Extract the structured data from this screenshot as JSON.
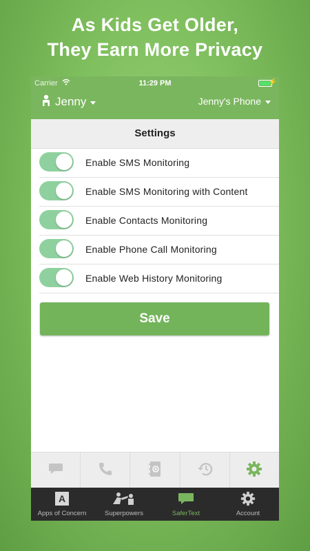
{
  "headline": {
    "line1": "As Kids Get Older,",
    "line2": "They Earn More Privacy"
  },
  "status_bar": {
    "carrier": "Carrier",
    "time": "11:29 PM"
  },
  "nav": {
    "child_name": "Jenny",
    "device_name": "Jenny's Phone"
  },
  "settings": {
    "title": "Settings",
    "rows": [
      {
        "label": "Enable SMS Monitoring",
        "enabled": true
      },
      {
        "label": "Enable SMS Monitoring with Content",
        "enabled": true
      },
      {
        "label": "Enable Contacts Monitoring",
        "enabled": true
      },
      {
        "label": "Enable Phone Call Monitoring",
        "enabled": true
      },
      {
        "label": "Enable Web History Monitoring",
        "enabled": true
      }
    ],
    "save_label": "Save"
  },
  "subtabs": [
    {
      "icon": "message-icon",
      "active": false
    },
    {
      "icon": "phone-icon",
      "active": false
    },
    {
      "icon": "contacts-icon",
      "active": false
    },
    {
      "icon": "history-icon",
      "active": false
    },
    {
      "icon": "gear-icon",
      "active": true
    }
  ],
  "tabbar": [
    {
      "label": "Apps of Concern",
      "icon": "apps-icon",
      "icon_text": "A",
      "active": false
    },
    {
      "label": "Superpowers",
      "icon": "superpowers-icon",
      "active": false
    },
    {
      "label": "SaferText",
      "icon": "chat-icon",
      "active": true
    },
    {
      "label": "Account",
      "icon": "gear-icon",
      "active": false
    }
  ],
  "colors": {
    "brand_green": "#7ab65e",
    "toggle_on": "#8fd19e",
    "tabbar_bg": "#2b2b2b"
  }
}
